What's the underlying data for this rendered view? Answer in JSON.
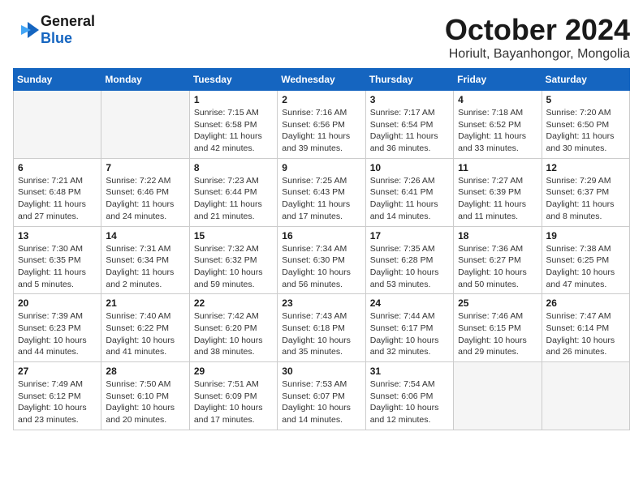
{
  "header": {
    "logo_line1": "General",
    "logo_line2": "Blue",
    "month": "October 2024",
    "location": "Horiult, Bayanhongor, Mongolia"
  },
  "days_of_week": [
    "Sunday",
    "Monday",
    "Tuesday",
    "Wednesday",
    "Thursday",
    "Friday",
    "Saturday"
  ],
  "weeks": [
    [
      {
        "day": "",
        "info": ""
      },
      {
        "day": "",
        "info": ""
      },
      {
        "day": "1",
        "info": "Sunrise: 7:15 AM\nSunset: 6:58 PM\nDaylight: 11 hours and 42 minutes."
      },
      {
        "day": "2",
        "info": "Sunrise: 7:16 AM\nSunset: 6:56 PM\nDaylight: 11 hours and 39 minutes."
      },
      {
        "day": "3",
        "info": "Sunrise: 7:17 AM\nSunset: 6:54 PM\nDaylight: 11 hours and 36 minutes."
      },
      {
        "day": "4",
        "info": "Sunrise: 7:18 AM\nSunset: 6:52 PM\nDaylight: 11 hours and 33 minutes."
      },
      {
        "day": "5",
        "info": "Sunrise: 7:20 AM\nSunset: 6:50 PM\nDaylight: 11 hours and 30 minutes."
      }
    ],
    [
      {
        "day": "6",
        "info": "Sunrise: 7:21 AM\nSunset: 6:48 PM\nDaylight: 11 hours and 27 minutes."
      },
      {
        "day": "7",
        "info": "Sunrise: 7:22 AM\nSunset: 6:46 PM\nDaylight: 11 hours and 24 minutes."
      },
      {
        "day": "8",
        "info": "Sunrise: 7:23 AM\nSunset: 6:44 PM\nDaylight: 11 hours and 21 minutes."
      },
      {
        "day": "9",
        "info": "Sunrise: 7:25 AM\nSunset: 6:43 PM\nDaylight: 11 hours and 17 minutes."
      },
      {
        "day": "10",
        "info": "Sunrise: 7:26 AM\nSunset: 6:41 PM\nDaylight: 11 hours and 14 minutes."
      },
      {
        "day": "11",
        "info": "Sunrise: 7:27 AM\nSunset: 6:39 PM\nDaylight: 11 hours and 11 minutes."
      },
      {
        "day": "12",
        "info": "Sunrise: 7:29 AM\nSunset: 6:37 PM\nDaylight: 11 hours and 8 minutes."
      }
    ],
    [
      {
        "day": "13",
        "info": "Sunrise: 7:30 AM\nSunset: 6:35 PM\nDaylight: 11 hours and 5 minutes."
      },
      {
        "day": "14",
        "info": "Sunrise: 7:31 AM\nSunset: 6:34 PM\nDaylight: 11 hours and 2 minutes."
      },
      {
        "day": "15",
        "info": "Sunrise: 7:32 AM\nSunset: 6:32 PM\nDaylight: 10 hours and 59 minutes."
      },
      {
        "day": "16",
        "info": "Sunrise: 7:34 AM\nSunset: 6:30 PM\nDaylight: 10 hours and 56 minutes."
      },
      {
        "day": "17",
        "info": "Sunrise: 7:35 AM\nSunset: 6:28 PM\nDaylight: 10 hours and 53 minutes."
      },
      {
        "day": "18",
        "info": "Sunrise: 7:36 AM\nSunset: 6:27 PM\nDaylight: 10 hours and 50 minutes."
      },
      {
        "day": "19",
        "info": "Sunrise: 7:38 AM\nSunset: 6:25 PM\nDaylight: 10 hours and 47 minutes."
      }
    ],
    [
      {
        "day": "20",
        "info": "Sunrise: 7:39 AM\nSunset: 6:23 PM\nDaylight: 10 hours and 44 minutes."
      },
      {
        "day": "21",
        "info": "Sunrise: 7:40 AM\nSunset: 6:22 PM\nDaylight: 10 hours and 41 minutes."
      },
      {
        "day": "22",
        "info": "Sunrise: 7:42 AM\nSunset: 6:20 PM\nDaylight: 10 hours and 38 minutes."
      },
      {
        "day": "23",
        "info": "Sunrise: 7:43 AM\nSunset: 6:18 PM\nDaylight: 10 hours and 35 minutes."
      },
      {
        "day": "24",
        "info": "Sunrise: 7:44 AM\nSunset: 6:17 PM\nDaylight: 10 hours and 32 minutes."
      },
      {
        "day": "25",
        "info": "Sunrise: 7:46 AM\nSunset: 6:15 PM\nDaylight: 10 hours and 29 minutes."
      },
      {
        "day": "26",
        "info": "Sunrise: 7:47 AM\nSunset: 6:14 PM\nDaylight: 10 hours and 26 minutes."
      }
    ],
    [
      {
        "day": "27",
        "info": "Sunrise: 7:49 AM\nSunset: 6:12 PM\nDaylight: 10 hours and 23 minutes."
      },
      {
        "day": "28",
        "info": "Sunrise: 7:50 AM\nSunset: 6:10 PM\nDaylight: 10 hours and 20 minutes."
      },
      {
        "day": "29",
        "info": "Sunrise: 7:51 AM\nSunset: 6:09 PM\nDaylight: 10 hours and 17 minutes."
      },
      {
        "day": "30",
        "info": "Sunrise: 7:53 AM\nSunset: 6:07 PM\nDaylight: 10 hours and 14 minutes."
      },
      {
        "day": "31",
        "info": "Sunrise: 7:54 AM\nSunset: 6:06 PM\nDaylight: 10 hours and 12 minutes."
      },
      {
        "day": "",
        "info": ""
      },
      {
        "day": "",
        "info": ""
      }
    ]
  ]
}
